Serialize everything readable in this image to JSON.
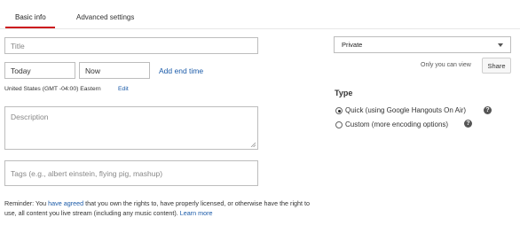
{
  "tabs": [
    {
      "label": "Basic info",
      "active": true
    },
    {
      "label": "Advanced settings",
      "active": false
    }
  ],
  "form": {
    "title_placeholder": "Title",
    "date_value": "Today",
    "time_value": "Now",
    "add_end_time_label": "Add end time",
    "timezone_text": "United States (GMT -04:00) Eastern",
    "timezone_edit_label": "Edit",
    "description_placeholder": "Description",
    "tags_placeholder": "Tags (e.g., albert einstein, flying pig, mashup)"
  },
  "reminder": {
    "prefix": "Reminder: You ",
    "agreed_link": "have agreed",
    "middle": " that you own the rights to, have properly licensed, or otherwise have the right to use, all content you live stream (including any music content). ",
    "learn_more_link": "Learn more"
  },
  "privacy": {
    "selected": "Private",
    "visibility_note": "Only you can view",
    "share_label": "Share"
  },
  "type": {
    "heading": "Type",
    "options": [
      {
        "label": "Quick (using Google Hangouts On Air)",
        "checked": true
      },
      {
        "label": "Custom (more encoding options)",
        "checked": false
      }
    ]
  },
  "colors": {
    "accent": "#cc181e",
    "link": "#1a5aa8"
  }
}
